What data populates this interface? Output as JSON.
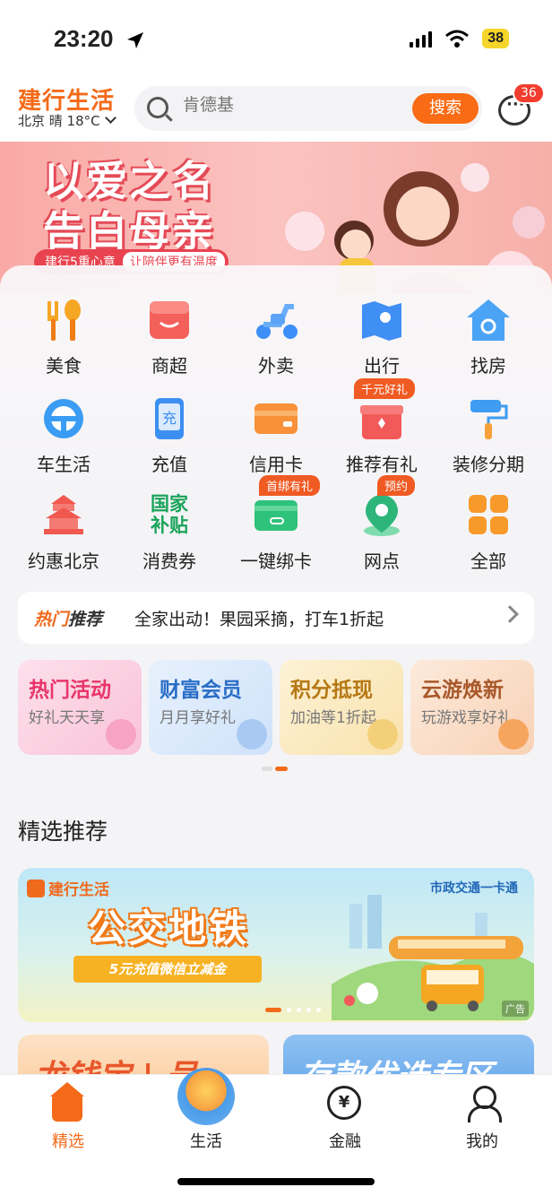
{
  "status_bar": {
    "time": "23:20",
    "battery": "38"
  },
  "header": {
    "brand": "建行生活",
    "weather": "北京 晴 18°C",
    "search_placeholder": "肯德基",
    "search_button": "搜索",
    "message_count": "36"
  },
  "banner": {
    "title_line1": "以爱之名",
    "title_line2": "告白母亲",
    "tag_left": "建行5重心意",
    "tag_right": "让陪伴更有温度"
  },
  "grid": [
    {
      "label": "美食",
      "icon": "fork-spoon-icon",
      "color": "#f5a623"
    },
    {
      "label": "商超",
      "icon": "store-icon",
      "color": "#f4605a"
    },
    {
      "label": "外卖",
      "icon": "scooter-icon",
      "color": "#3d8ef7"
    },
    {
      "label": "出行",
      "icon": "map-icon",
      "color": "#3f8ff4"
    },
    {
      "label": "找房",
      "icon": "house-search-icon",
      "color": "#4aa3f5"
    },
    {
      "label": "车生活",
      "icon": "steering-wheel-icon",
      "color": "#3a9cf3"
    },
    {
      "label": "充值",
      "icon": "phone-recharge-icon",
      "color": "#3b8ff2"
    },
    {
      "label": "信用卡",
      "icon": "credit-card-icon",
      "color": "#f7913a"
    },
    {
      "label": "推荐有礼",
      "icon": "gift-box-icon",
      "color": "#f25a5a",
      "tag": "千元好礼"
    },
    {
      "label": "装修分期",
      "icon": "paint-roller-icon",
      "color": "#3f9cf0"
    },
    {
      "label": "约惠北京",
      "icon": "temple-icon",
      "color": "#f1584f"
    },
    {
      "label": "消费券",
      "icon": "national-subsidy-icon",
      "color": "#1aa35a",
      "icon_text": "国家补贴"
    },
    {
      "label": "一键绑卡",
      "icon": "bind-card-icon",
      "color": "#2ec27a",
      "tag": "首绑有礼"
    },
    {
      "label": "网点",
      "icon": "location-pin-icon",
      "color": "#2db57a",
      "tag": "预约"
    },
    {
      "label": "全部",
      "icon": "all-apps-icon",
      "color": "#f79a2a"
    }
  ],
  "hot": {
    "tag_a": "热门",
    "tag_b": "推荐",
    "text": "全家出动！果园采摘，打车1折起"
  },
  "cards": [
    {
      "title": "热门活动",
      "subtitle": "好礼天天享",
      "title_color": "#e8356b",
      "bg": "#fdd6e4"
    },
    {
      "title": "财富会员",
      "subtitle": "月月享好礼",
      "title_color": "#2a6ec7",
      "bg": "#dbe9fb"
    },
    {
      "title": "积分抵现",
      "subtitle": "加油等1折起",
      "title_color": "#b67814",
      "bg": "#fbeccb"
    },
    {
      "title": "云游焕新",
      "subtitle": "玩游戏享好礼",
      "title_color": "#a8582a",
      "bg": "#fbe1cf"
    }
  ],
  "section_title": "精选推荐",
  "promo": {
    "brand": "建行生活",
    "partner": "市政交通一卡通",
    "title": "公交地铁",
    "ribbon": "5元充值微信立减金",
    "ad": "广告"
  },
  "half_cards": [
    {
      "title": "龙钱宝 | 号",
      "color": "#e8572a",
      "bg": "#fde2c7"
    },
    {
      "title": "存款优选专区",
      "color": "#ffffff",
      "bg": "#7fb6ef"
    }
  ],
  "tabs": [
    {
      "label": "精选",
      "active": true
    },
    {
      "label": "生活",
      "active": false
    },
    {
      "label": "金融",
      "active": false
    },
    {
      "label": "我的",
      "active": false
    }
  ],
  "colors": {
    "accent": "#f46a18"
  }
}
